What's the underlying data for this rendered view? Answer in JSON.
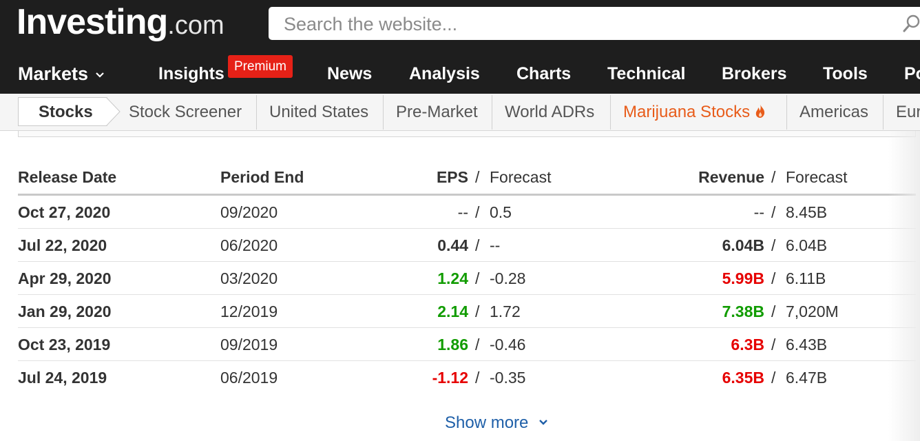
{
  "header": {
    "logo_main": "Investing",
    "logo_suffix": ".com",
    "search_placeholder": "Search the website..."
  },
  "main_nav": {
    "markets": "Markets",
    "insights": "Insights",
    "premium_badge": "Premium",
    "news": "News",
    "analysis": "Analysis",
    "charts": "Charts",
    "technical": "Technical",
    "brokers": "Brokers",
    "tools": "Tools",
    "partial": "Po"
  },
  "sub_nav": {
    "stocks": "Stocks",
    "stock_screener": "Stock Screener",
    "united_states": "United States",
    "pre_market": "Pre-Market",
    "world_adrs": "World ADRs",
    "marijuana_stocks": "Marijuana Stocks",
    "americas": "Americas",
    "partial": "Eur"
  },
  "earnings_table": {
    "headers": {
      "release_date": "Release Date",
      "period_end": "Period End",
      "eps": "EPS",
      "eps_forecast": "Forecast",
      "revenue": "Revenue",
      "revenue_forecast": "Forecast",
      "separator": "/"
    },
    "rows": [
      {
        "release_date": "Oct 27, 2020",
        "period_end": "09/2020",
        "eps": "--",
        "eps_status": "none",
        "eps_forecast": "0.5",
        "revenue": "--",
        "revenue_status": "none",
        "revenue_forecast": "8.45B"
      },
      {
        "release_date": "Jul 22, 2020",
        "period_end": "06/2020",
        "eps": "0.44",
        "eps_status": "neutral",
        "eps_forecast": "--",
        "revenue": "6.04B",
        "revenue_status": "neutral",
        "revenue_forecast": "6.04B"
      },
      {
        "release_date": "Apr 29, 2020",
        "period_end": "03/2020",
        "eps": "1.24",
        "eps_status": "beat",
        "eps_forecast": "-0.28",
        "revenue": "5.99B",
        "revenue_status": "miss",
        "revenue_forecast": "6.11B"
      },
      {
        "release_date": "Jan 29, 2020",
        "period_end": "12/2019",
        "eps": "2.14",
        "eps_status": "beat",
        "eps_forecast": "1.72",
        "revenue": "7.38B",
        "revenue_status": "beat",
        "revenue_forecast": "7,020M"
      },
      {
        "release_date": "Oct 23, 2019",
        "period_end": "09/2019",
        "eps": "1.86",
        "eps_status": "beat",
        "eps_forecast": "-0.46",
        "revenue": "6.3B",
        "revenue_status": "miss",
        "revenue_forecast": "6.43B"
      },
      {
        "release_date": "Jul 24, 2019",
        "period_end": "06/2019",
        "eps": "-1.12",
        "eps_status": "miss",
        "eps_forecast": "-0.35",
        "revenue": "6.35B",
        "revenue_status": "miss",
        "revenue_forecast": "6.47B"
      }
    ]
  },
  "show_more": "Show more",
  "colors": {
    "header_bg": "#1e1e1e",
    "premium_red": "#e62117",
    "beat_green": "#119c00",
    "miss_red": "#e60000",
    "link_blue": "#1e5fa8",
    "highlight_orange": "#e85c1a"
  }
}
